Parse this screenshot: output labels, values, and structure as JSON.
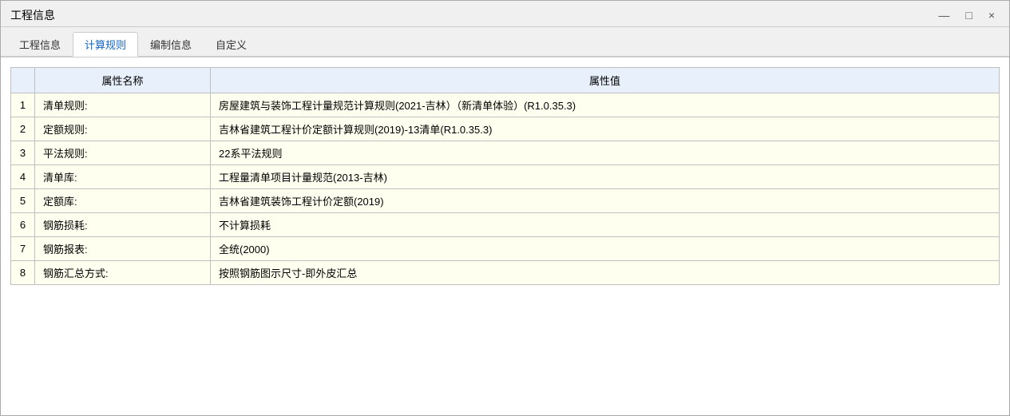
{
  "window": {
    "title": "工程信息",
    "controls": {
      "minimize": "—",
      "maximize": "□",
      "close": "×"
    }
  },
  "tabs": [
    {
      "id": "engineering-info",
      "label": "工程信息",
      "active": false
    },
    {
      "id": "calc-rules",
      "label": "计算规则",
      "active": true
    },
    {
      "id": "compile-info",
      "label": "编制信息",
      "active": false
    },
    {
      "id": "custom",
      "label": "自定义",
      "active": false
    }
  ],
  "table": {
    "headers": {
      "index": "",
      "prop_name": "属性名称",
      "prop_value": "属性值"
    },
    "rows": [
      {
        "index": "1",
        "name": "清单规则:",
        "value": "房屋建筑与装饰工程计量规范计算规则(2021-吉林）（新清单体验）(R1.0.35.3)"
      },
      {
        "index": "2",
        "name": "定额规则:",
        "value": "吉林省建筑工程计价定额计算规则(2019)-13清单(R1.0.35.3)"
      },
      {
        "index": "3",
        "name": "平法规则:",
        "value": "22系平法规则"
      },
      {
        "index": "4",
        "name": "清单库:",
        "value": "工程量清单项目计量规范(2013-吉林)"
      },
      {
        "index": "5",
        "name": "定额库:",
        "value": "吉林省建筑装饰工程计价定额(2019)"
      },
      {
        "index": "6",
        "name": "钢筋损耗:",
        "value": "不计算损耗"
      },
      {
        "index": "7",
        "name": "钢筋报表:",
        "value": "全统(2000)"
      },
      {
        "index": "8",
        "name": "钢筋汇总方式:",
        "value": "按照钢筋图示尺寸-即外皮汇总"
      }
    ]
  }
}
